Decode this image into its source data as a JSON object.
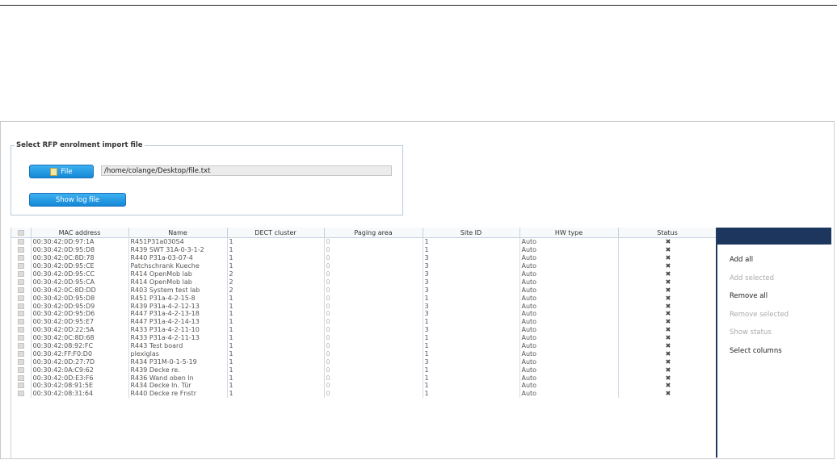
{
  "import": {
    "legend": "Select RFP enrolment import file",
    "file_button": "File",
    "file_path": "/home/colange/Desktop/file.txt",
    "log_button": "Show log file"
  },
  "table": {
    "columns": [
      "MAC address",
      "Name",
      "DECT cluster",
      "Paging area",
      "Site ID",
      "HW type",
      "Status"
    ],
    "status_icon": "✖",
    "rows": [
      [
        "00:30:42:0D:97:1A",
        "R451P31a030S4",
        "1",
        "0",
        "1",
        "Auto"
      ],
      [
        "00:30:42:0D:95:D8",
        "R439 SWT 31A-0-3-1-2",
        "1",
        "0",
        "1",
        "Auto"
      ],
      [
        "00:30:42:0C:8D:78",
        "R440 P31a-03-07-4",
        "1",
        "0",
        "3",
        "Auto"
      ],
      [
        "00:30:42:0D:95:CE",
        "Patchschrank Kueche",
        "1",
        "0",
        "3",
        "Auto"
      ],
      [
        "00:30:42:0D:95:CC",
        "R414 OpenMob lab",
        "2",
        "0",
        "3",
        "Auto"
      ],
      [
        "00:30:42:0D:95:CA",
        "R414 OpenMob lab",
        "2",
        "0",
        "3",
        "Auto"
      ],
      [
        "00:30:42:0C:8D:DD",
        "R403 System test lab",
        "2",
        "0",
        "3",
        "Auto"
      ],
      [
        "00:30:42:0D:95:D8",
        "R451 P31a-4-2-15-8",
        "1",
        "0",
        "1",
        "Auto"
      ],
      [
        "00:30:42:0D:95:D9",
        "R439 P31a-4-2-12-13",
        "1",
        "0",
        "3",
        "Auto"
      ],
      [
        "00:30:42:0D:95:D6",
        "R447 P31a-4-2-13-18",
        "1",
        "0",
        "3",
        "Auto"
      ],
      [
        "00:30:42:0D:95:E7",
        "R447 P31a-4-2-14-13",
        "1",
        "0",
        "1",
        "Auto"
      ],
      [
        "00:30:42:0D:22:5A",
        "R433 P31a-4-2-11-10",
        "1",
        "0",
        "3",
        "Auto"
      ],
      [
        "00:30:42:0C:8D:68",
        "R433 P31a-4-2-11-13",
        "1",
        "0",
        "1",
        "Auto"
      ],
      [
        "00:30:42:08:92:FC",
        "R443 Test board",
        "1",
        "0",
        "1",
        "Auto"
      ],
      [
        "00:30:42:FF:F0:D0",
        "plexiglas",
        "1",
        "0",
        "1",
        "Auto"
      ],
      [
        "00:30:42:0D:27:7D",
        "R434 P31M-0-1-5-19",
        "1",
        "0",
        "3",
        "Auto"
      ],
      [
        "00:30:42:0A:C9:62",
        "R439 Decke re.",
        "1",
        "0",
        "1",
        "Auto"
      ],
      [
        "00:30:42:0D:E3:F6",
        "R436 Wand oben ln",
        "1",
        "0",
        "1",
        "Auto"
      ],
      [
        "00:30:42:08:91:5E",
        "R434 Decke ln. Tür",
        "1",
        "0",
        "1",
        "Auto"
      ],
      [
        "00:30:42:08:31:64",
        "R440 Decke re Fnstr",
        "1",
        "0",
        "1",
        "Auto"
      ]
    ]
  },
  "side_menu": [
    {
      "label": "Add all",
      "enabled": true
    },
    {
      "label": "Add selected",
      "enabled": false
    },
    {
      "label": "Remove all",
      "enabled": true
    },
    {
      "label": "Remove selected",
      "enabled": false
    },
    {
      "label": "Show status",
      "enabled": false
    },
    {
      "label": "Select columns",
      "enabled": true
    }
  ]
}
